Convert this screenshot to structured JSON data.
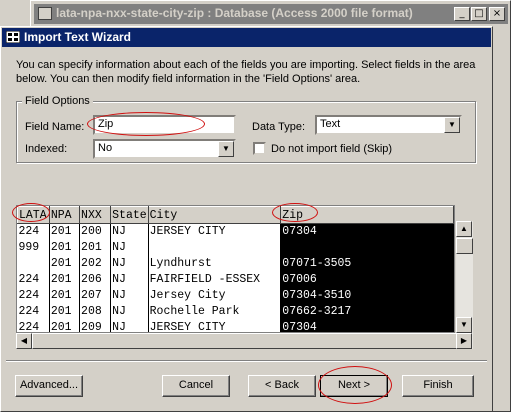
{
  "background_window": {
    "title": "lata-npa-nxx-state-city-zip : Database (Access 2000 file format)"
  },
  "dialog": {
    "title": "Import Text Wizard",
    "intro": "You can specify information about each of the fields you are importing.  Select fields in the area below. You can then modify field information in the 'Field Options' area."
  },
  "field_options": {
    "group_label": "Field Options",
    "field_name_label": "Field Name:",
    "field_name_value": "Zip",
    "data_type_label": "Data Type:",
    "data_type_value": "Text",
    "indexed_label": "Indexed:",
    "indexed_value": "No",
    "skip_label": "Do not import field (Skip)"
  },
  "grid": {
    "columns": [
      "LATA",
      "NPA",
      "NXX",
      "State",
      "City",
      "Zip"
    ],
    "rows": [
      [
        "224",
        "201",
        "200",
        "NJ",
        "JERSEY CITY",
        "07304"
      ],
      [
        "999",
        "201",
        "201",
        "NJ",
        "",
        ""
      ],
      [
        "",
        "201",
        "202",
        "NJ",
        "Lyndhurst",
        "07071-3505"
      ],
      [
        "224",
        "201",
        "206",
        "NJ",
        "FAIRFIELD -ESSEX",
        "07006"
      ],
      [
        "224",
        "201",
        "207",
        "NJ",
        "Jersey City",
        "07304-3510"
      ],
      [
        "224",
        "201",
        "208",
        "NJ",
        "Rochelle Park",
        "07662-3217"
      ],
      [
        "224",
        "201",
        "209",
        "NJ",
        "JERSEY CITY",
        "07304"
      ]
    ]
  },
  "buttons": {
    "advanced": "Advanced...",
    "cancel": "Cancel",
    "back": "< Back",
    "next": "Next >",
    "finish": "Finish"
  },
  "colors": {
    "title_active": "#0a246a",
    "title_inactive": "#808080",
    "annotation": "#d01010"
  }
}
